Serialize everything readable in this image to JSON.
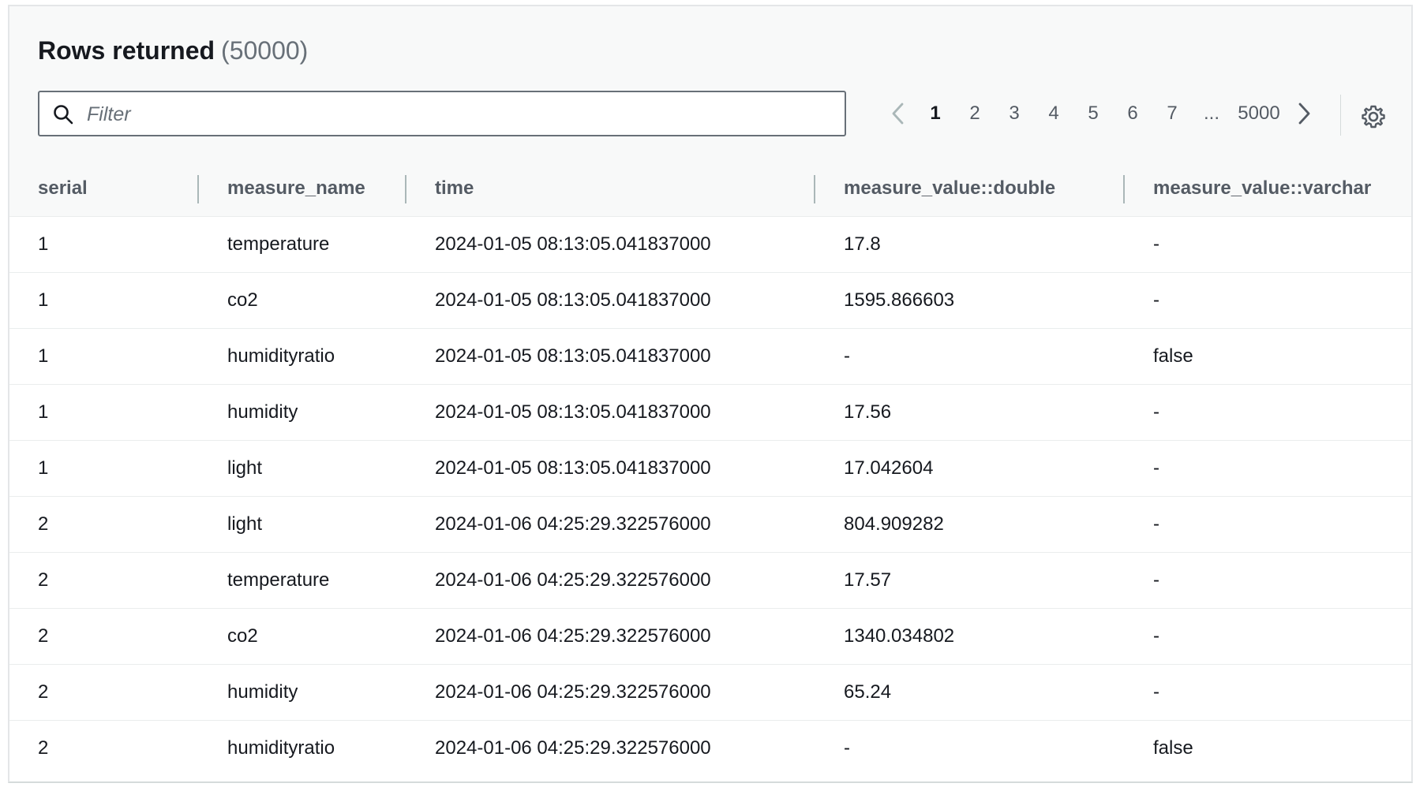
{
  "header": {
    "title": "Rows returned",
    "count": "(50000)"
  },
  "filter": {
    "placeholder": "Filter",
    "value": ""
  },
  "pagination": {
    "pages": [
      "1",
      "2",
      "3",
      "4",
      "5",
      "6",
      "7",
      "...",
      "5000"
    ],
    "current": "1"
  },
  "table": {
    "columns": [
      "serial",
      "measure_name",
      "time",
      "measure_value::double",
      "measure_value::varchar"
    ],
    "rows": [
      [
        "1",
        "temperature",
        "2024-01-05 08:13:05.041837000",
        "17.8",
        "-"
      ],
      [
        "1",
        "co2",
        "2024-01-05 08:13:05.041837000",
        "1595.866603",
        "-"
      ],
      [
        "1",
        "humidityratio",
        "2024-01-05 08:13:05.041837000",
        "-",
        "false"
      ],
      [
        "1",
        "humidity",
        "2024-01-05 08:13:05.041837000",
        "17.56",
        "-"
      ],
      [
        "1",
        "light",
        "2024-01-05 08:13:05.041837000",
        "17.042604",
        "-"
      ],
      [
        "2",
        "light",
        "2024-01-06 04:25:29.322576000",
        "804.909282",
        "-"
      ],
      [
        "2",
        "temperature",
        "2024-01-06 04:25:29.322576000",
        "17.57",
        "-"
      ],
      [
        "2",
        "co2",
        "2024-01-06 04:25:29.322576000",
        "1340.034802",
        "-"
      ],
      [
        "2",
        "humidity",
        "2024-01-06 04:25:29.322576000",
        "65.24",
        "-"
      ],
      [
        "2",
        "humidityratio",
        "2024-01-06 04:25:29.322576000",
        "-",
        "false"
      ]
    ]
  },
  "colors": {
    "text": "#16191f",
    "muted": "#687078",
    "header_bg": "#f8f9f9",
    "border": "#eaeded"
  },
  "icons": {
    "filter": "search-icon",
    "prev": "chevron-left-icon",
    "next": "chevron-right-icon",
    "preferences": "gear-icon"
  }
}
